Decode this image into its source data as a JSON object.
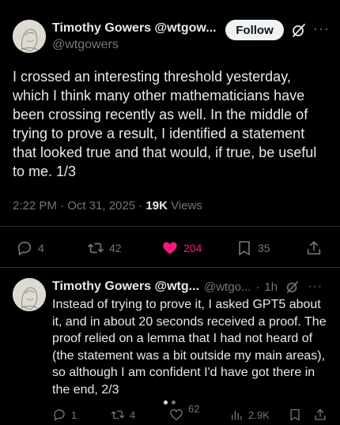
{
  "main_tweet": {
    "author_name": "Timothy Gowers",
    "author_header": "Timothy Gowers @wtgow...",
    "handle": "@wtgowers",
    "follow_label": "Follow",
    "text": "I crossed an interesting threshold yesterday, which I think many other mathematicians have been crossing recently as well. In the middle of trying to prove a result, I identified a statement that looked true and that would, if true, be useful to me. 1/3",
    "time": "2:22 PM · Oct 31, 2025 · ",
    "views_count": "19K",
    "views_label": " Views",
    "actions": {
      "replies": "4",
      "reposts": "42",
      "likes": "204",
      "bookmarks": "35"
    }
  },
  "reply_tweet": {
    "author_name": "Timothy Gowers @wtg...",
    "handle": "@wtgo...",
    "dot": "·",
    "time": "1h",
    "text": "Instead of trying to prove it, I asked GPT5 about it, and in about 20 seconds received a proof. The proof relied on a lemma that I had not heard of (the statement was a bit outside my main areas), so although I am confident I'd have got there in the end, 2/3",
    "actions": {
      "replies": "1",
      "reposts": "4",
      "likes": "62",
      "views": "2.9K"
    }
  },
  "colors": {
    "background": "#000000",
    "text_primary": "#e7e9ea",
    "text_secondary": "#71767b",
    "like": "#f91880",
    "divider": "#2f3336"
  },
  "icons": {
    "reply": "reply-icon",
    "repost": "repost-icon",
    "like": "heart-icon",
    "bookmark": "bookmark-icon",
    "share": "share-icon",
    "views": "views-icon",
    "grok": "grok-icon",
    "more": "more-icon"
  }
}
